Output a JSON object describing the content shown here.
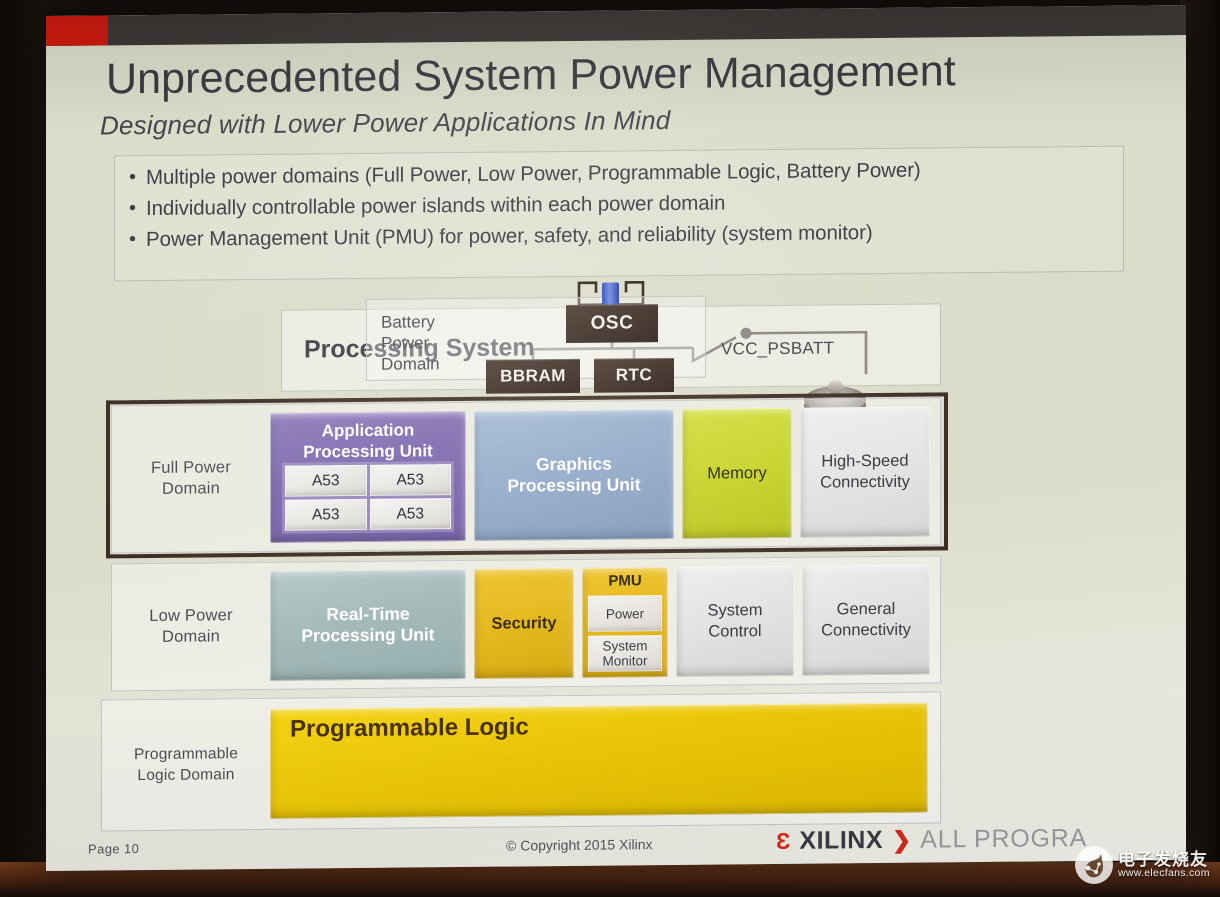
{
  "header": {
    "title": "Unprecedented System Power Management",
    "subtitle": "Designed with Lower Power Applications In Mind"
  },
  "bullets": [
    "Multiple power domains (Full Power, Low Power, Programmable Logic, Battery Power)",
    "Individually controllable power islands within each power domain",
    "Power Management Unit (PMU) for power, safety, and reliability (system monitor)"
  ],
  "diagram": {
    "processing_system_label": "Processing System",
    "battery_power_domain_label": "Battery\nPower\nDomain",
    "osc_label": "OSC",
    "bbram_label": "BBRAM",
    "rtc_label": "RTC",
    "vcc_label": "VCC_PSBATT",
    "rows": [
      {
        "domain_label": "Full Power\nDomain",
        "highlighted": true,
        "blocks": [
          {
            "label": "Application\nProcessing Unit",
            "color": "#7d68ad",
            "cores": [
              "A53",
              "A53",
              "A53",
              "A53"
            ]
          },
          {
            "label": "Graphics\nProcessing Unit",
            "color": "#91a9c8"
          },
          {
            "label": "Memory",
            "color": "#c6d226"
          },
          {
            "label": "High-Speed\nConnectivity",
            "color": "#e4e3e3"
          }
        ]
      },
      {
        "domain_label": "Low Power\nDomain",
        "highlighted": false,
        "blocks": [
          {
            "label": "Real-Time\nProcessing Unit",
            "color": "#a1b8b7"
          },
          {
            "label": "Security",
            "color": "#e4b516"
          },
          {
            "label": "PMU",
            "color": "#e4b516",
            "sub_blocks": [
              "Power",
              "System\nMonitor"
            ]
          },
          {
            "label": "System\nControl",
            "color": "#e3e0e0"
          },
          {
            "label": "General\nConnectivity",
            "color": "#e3e0e0"
          }
        ]
      },
      {
        "domain_label": "Programmable\nLogic Domain",
        "highlighted": false,
        "blocks": [
          {
            "label": "Programmable Logic",
            "color": "#ecc808"
          }
        ]
      }
    ]
  },
  "footer": {
    "page": "Page  10",
    "copyright": "© Copyright 2015 Xilinx",
    "brand_bracket_left": "Ɛ",
    "brand_name": "XILINX",
    "brand_arrow": "❯",
    "brand_tagline": "ALL PROGRA"
  },
  "watermark": {
    "cn": "电子发烧友",
    "url": "www.elecfans.com"
  },
  "colors": {
    "accent_red": "#cf1b10",
    "slide_bg": "#dcdccb",
    "highlight_border": "#3b2c22"
  }
}
